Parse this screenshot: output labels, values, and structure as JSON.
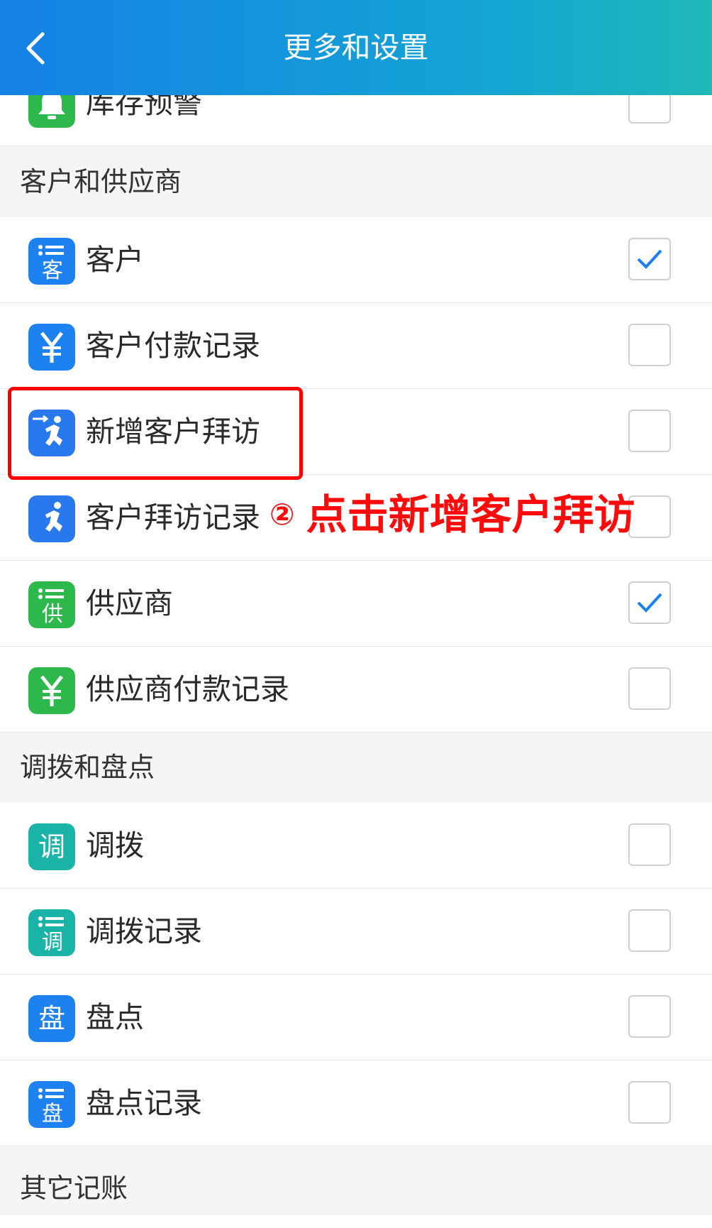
{
  "header": {
    "title": "更多和设置",
    "back_icon": "chevron-left-icon"
  },
  "colors": {
    "header_start": "#1581e6",
    "header_end": "#1fb9b8",
    "blue": "#1d82f0",
    "green": "#2cb84a",
    "teal": "#1ab3a8",
    "annotation": "#ff0a0a",
    "check": "#1a7ff0"
  },
  "top_row": {
    "label": "库存预警",
    "icon": "bell-icon",
    "checked": false
  },
  "sections": [
    {
      "title": "客户和供应商",
      "items": [
        {
          "label": "客户",
          "icon": "customer-list-icon",
          "checked": true
        },
        {
          "label": "客户付款记录",
          "icon": "yen-icon",
          "checked": false
        },
        {
          "label": "新增客户拜访",
          "icon": "add-visit-icon",
          "checked": false
        },
        {
          "label": "客户拜访记录",
          "icon": "visit-record-icon",
          "checked": false
        },
        {
          "label": "供应商",
          "icon": "supplier-list-icon",
          "checked": true
        },
        {
          "label": "供应商付款记录",
          "icon": "yen-icon",
          "checked": false
        }
      ]
    },
    {
      "title": "调拨和盘点",
      "items": [
        {
          "label": "调拨",
          "icon": "transfer-icon",
          "checked": false
        },
        {
          "label": "调拨记录",
          "icon": "transfer-record-icon",
          "checked": false
        },
        {
          "label": "盘点",
          "icon": "stocktake-icon",
          "checked": false
        },
        {
          "label": "盘点记录",
          "icon": "stocktake-record-icon",
          "checked": false
        }
      ]
    },
    {
      "title": "其它记账",
      "items": []
    }
  ],
  "annotation": {
    "number": "②",
    "text": "点击新增客户拜访"
  }
}
